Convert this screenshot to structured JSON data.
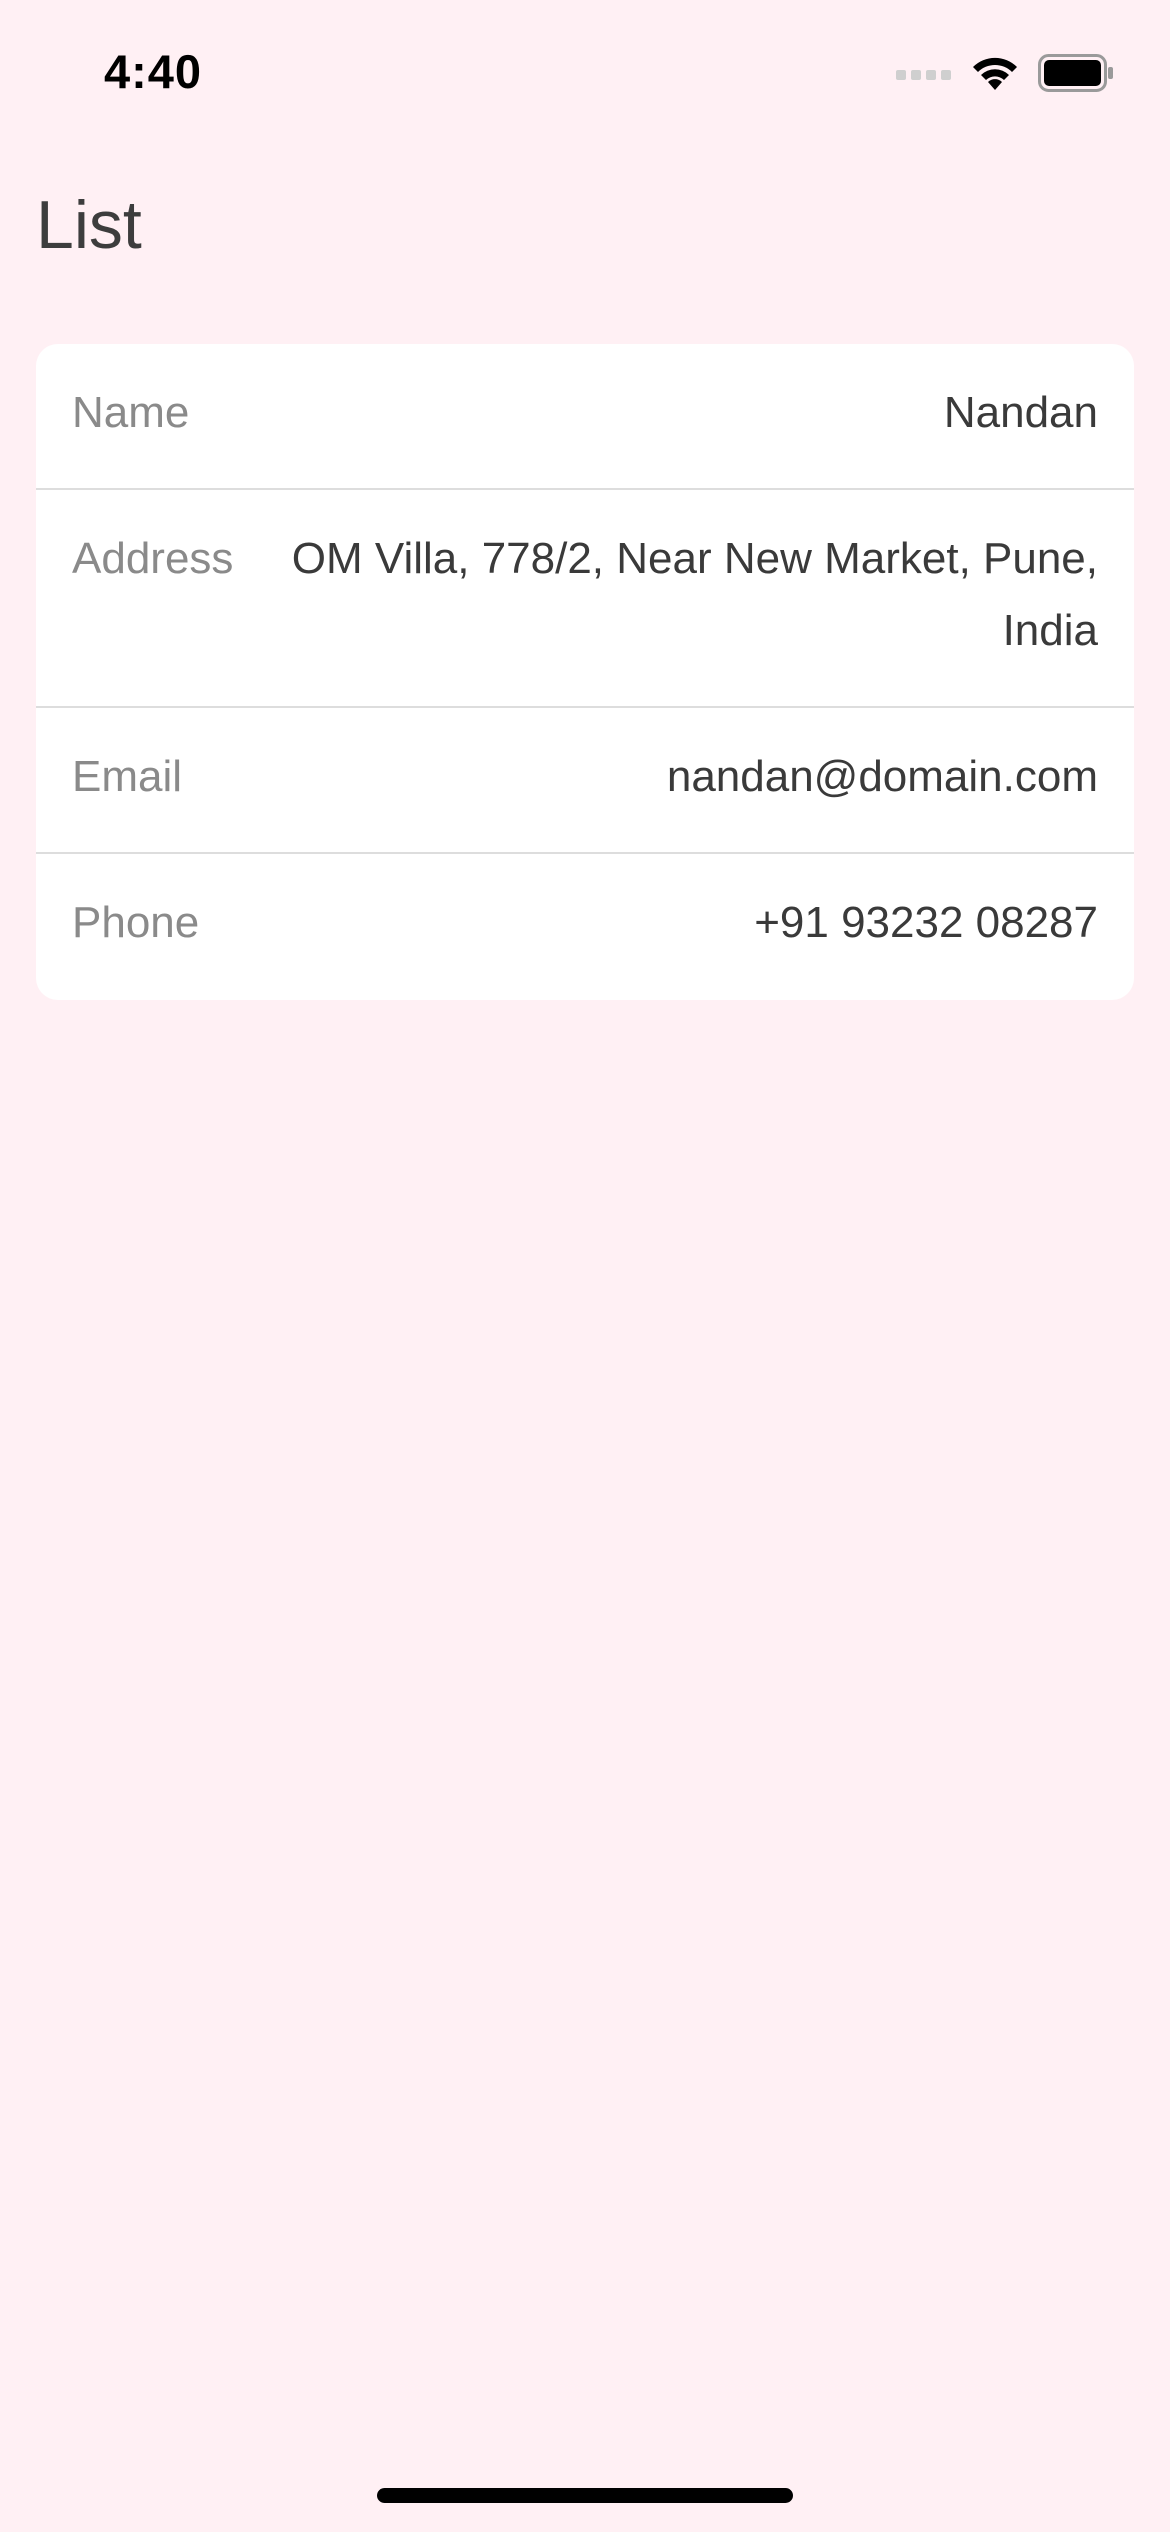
{
  "status_bar": {
    "time": "4:40",
    "signal_icon": "cellular-signal-icon",
    "wifi_icon": "wifi-icon",
    "battery_icon": "battery-icon"
  },
  "page": {
    "title": "List"
  },
  "details": {
    "rows": [
      {
        "label": "Name",
        "value": "Nandan"
      },
      {
        "label": "Address",
        "value": "OM Villa, 778/2, Near New Market, Pune, India"
      },
      {
        "label": "Email",
        "value": "nandan@domain.com"
      },
      {
        "label": "Phone",
        "value": "+91 93232 08287"
      }
    ]
  },
  "colors": {
    "background": "#fff0f4",
    "card": "#ffffff",
    "label": "#8a8a8a",
    "value": "#3a3a3a",
    "divider": "#dddddd"
  }
}
